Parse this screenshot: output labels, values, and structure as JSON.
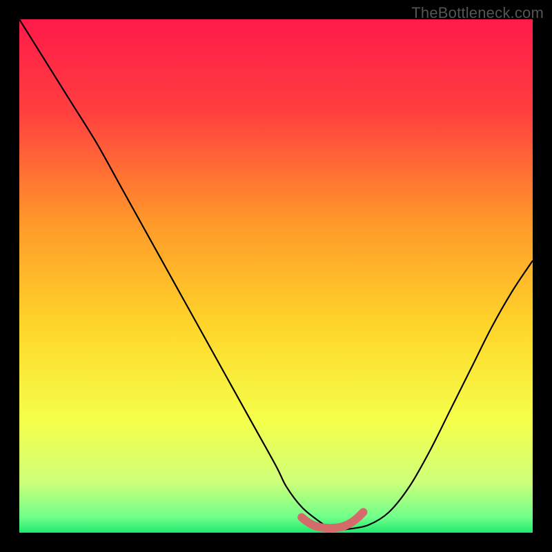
{
  "watermark": "TheBottleneck.com",
  "chart_data": {
    "type": "line",
    "title": "",
    "xlabel": "",
    "ylabel": "",
    "xlim": [
      0,
      100
    ],
    "ylim": [
      0,
      100
    ],
    "background_gradient_stops": [
      {
        "pos": 0.0,
        "color": "#ff1a4a"
      },
      {
        "pos": 0.18,
        "color": "#ff3f3f"
      },
      {
        "pos": 0.4,
        "color": "#ff9a2a"
      },
      {
        "pos": 0.6,
        "color": "#ffd62a"
      },
      {
        "pos": 0.78,
        "color": "#f5ff4a"
      },
      {
        "pos": 0.9,
        "color": "#cfff7a"
      },
      {
        "pos": 0.97,
        "color": "#6fff8a"
      },
      {
        "pos": 1.0,
        "color": "#20e870"
      }
    ],
    "series": [
      {
        "name": "bottleneck-curve",
        "color": "#000000",
        "x": [
          0,
          5,
          10,
          15,
          20,
          25,
          30,
          35,
          40,
          45,
          50,
          52,
          55,
          58,
          60,
          62,
          64,
          68,
          72,
          76,
          80,
          84,
          88,
          92,
          96,
          100
        ],
        "y": [
          100,
          92,
          84,
          76,
          67,
          58,
          49,
          40,
          31,
          22,
          13,
          9,
          5,
          2.5,
          1.2,
          0.7,
          0.7,
          1.5,
          4,
          9,
          16,
          24,
          32,
          40,
          47,
          53
        ]
      },
      {
        "name": "optimal-zone-marker",
        "color": "#d46a6a",
        "x": [
          55,
          56,
          57,
          58,
          59,
          60,
          61,
          62,
          63,
          64,
          65,
          66,
          67
        ],
        "y": [
          3.0,
          2.2,
          1.6,
          1.2,
          1.0,
          0.9,
          0.9,
          1.0,
          1.2,
          1.6,
          2.2,
          3.0,
          4.0
        ]
      }
    ]
  }
}
